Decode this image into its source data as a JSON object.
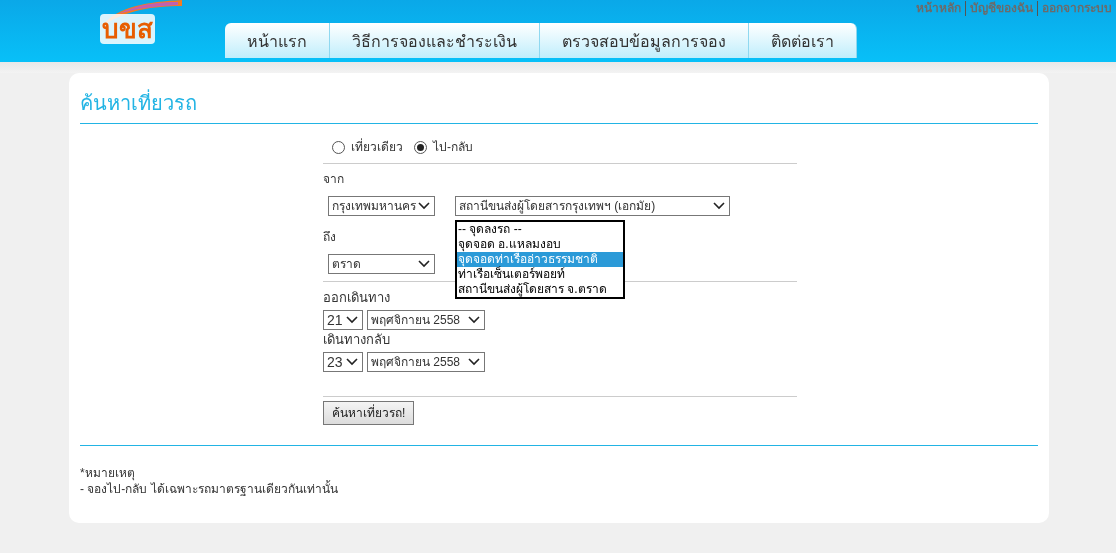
{
  "logo": "บขส",
  "top_links": [
    "หน้าหลัก",
    "บัญชีของฉัน",
    "ออกจากระบบ"
  ],
  "tabs": [
    "หน้าแรก",
    "วิธีการจองและชำระเงิน",
    "ตรวจสอบข้อมูลการจอง",
    "ติดต่อเรา"
  ],
  "title": "ค้นหาเที่ยวรถ",
  "trip_type": [
    {
      "label": "เที่ยวเดียว",
      "selected": false
    },
    {
      "label": "ไป-กลับ",
      "selected": true
    }
  ],
  "from": {
    "label": "จาก",
    "province": "กรุงเทพมหานคร",
    "station": "สถานีขนส่งผู้โดยสารกรุงเทพฯ (เอกมัย)"
  },
  "dropdown_list": [
    {
      "label": "-- จุดลงรถ --",
      "selected": false
    },
    {
      "label": "จุดจอด อ.แหลมงอบ",
      "selected": false
    },
    {
      "label": "จุดจอดท่าเรืออ่าวธรรมชาติ",
      "selected": true
    },
    {
      "label": "ท่าเรือเซ็นเตอร์พอยท์",
      "selected": false
    },
    {
      "label": "สถานีขนส่งผู้โดยสาร จ.ตราด",
      "selected": false
    }
  ],
  "to": {
    "label": "ถึง",
    "province": "ตราด"
  },
  "depart": {
    "label": "ออกเดินทาง",
    "day": "21",
    "month": "พฤศจิกายน 2558"
  },
  "return": {
    "label": "เดินทางกลับ",
    "day": "23",
    "month": "พฤศจิกายน 2558"
  },
  "search_button": "ค้นหาเที่ยวรถ!",
  "notes": [
    "*หมายเหตุ",
    "- จองไป-กลับ ได้เฉพาะรถมาตรฐานเดียวกันเท่านั้น"
  ]
}
